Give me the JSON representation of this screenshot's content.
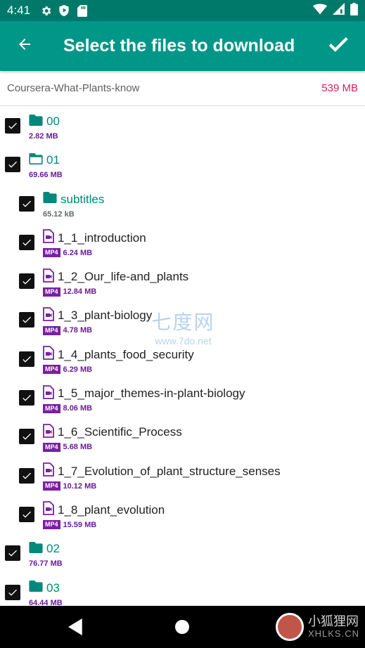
{
  "status_bar": {
    "time": "4:41",
    "icons": [
      "gear-icon",
      "shield-icon",
      "sdcard-icon",
      "wifi-icon",
      "signal-icon",
      "battery-icon"
    ]
  },
  "app_bar": {
    "title": "Select the files to download",
    "back_icon": "arrow-left-icon",
    "confirm_icon": "checkmark-icon"
  },
  "summary": {
    "name": "Coursera-What-Plants-know",
    "size": "539 MB"
  },
  "items": [
    {
      "type": "folder",
      "level": 0,
      "name": "00",
      "size": "2.82 MB",
      "checked": true,
      "open": false
    },
    {
      "type": "folder",
      "level": 0,
      "name": "01",
      "size": "69.66 MB",
      "checked": true,
      "open": true
    },
    {
      "type": "folder",
      "level": 1,
      "name": "subtitles",
      "size": "65.12 kB",
      "checked": true,
      "open": false
    },
    {
      "type": "file",
      "level": 1,
      "name": "1_1_introduction",
      "badge": "MP4",
      "size": "6.24 MB",
      "checked": true
    },
    {
      "type": "file",
      "level": 1,
      "name": "1_2_Our_life-and_plants",
      "badge": "MP4",
      "size": "12.84 MB",
      "checked": true
    },
    {
      "type": "file",
      "level": 1,
      "name": "1_3_plant-biology",
      "badge": "MP4",
      "size": "4.78 MB",
      "checked": true
    },
    {
      "type": "file",
      "level": 1,
      "name": "1_4_plants_food_security",
      "badge": "MP4",
      "size": "6.29 MB",
      "checked": true
    },
    {
      "type": "file",
      "level": 1,
      "name": "1_5_major_themes-in-plant-biology",
      "badge": "MP4",
      "size": "8.06 MB",
      "checked": true
    },
    {
      "type": "file",
      "level": 1,
      "name": "1_6_Scientific_Process",
      "badge": "MP4",
      "size": "5.68 MB",
      "checked": true
    },
    {
      "type": "file",
      "level": 1,
      "name": "1_7_Evolution_of_plant_structure_senses",
      "badge": "MP4",
      "size": "10.12 MB",
      "checked": true
    },
    {
      "type": "file",
      "level": 1,
      "name": "1_8_plant_evolution",
      "badge": "MP4",
      "size": "15.59 MB",
      "checked": true
    },
    {
      "type": "folder",
      "level": 0,
      "name": "02",
      "size": "76.77 MB",
      "checked": true,
      "open": false
    },
    {
      "type": "folder",
      "level": 0,
      "name": "03",
      "size": "64.44 MB",
      "checked": true,
      "open": false
    }
  ],
  "watermark": {
    "text": "七度网",
    "url": "www.7do.net"
  },
  "corner_watermark": {
    "text": "小狐狸网",
    "sub": "XHLKS.CN"
  },
  "colors": {
    "status_bar": "#00796b",
    "app_bar": "#009688",
    "folder": "#00897b",
    "badge": "#7b1fa2",
    "accent_size": "#d81b60"
  }
}
